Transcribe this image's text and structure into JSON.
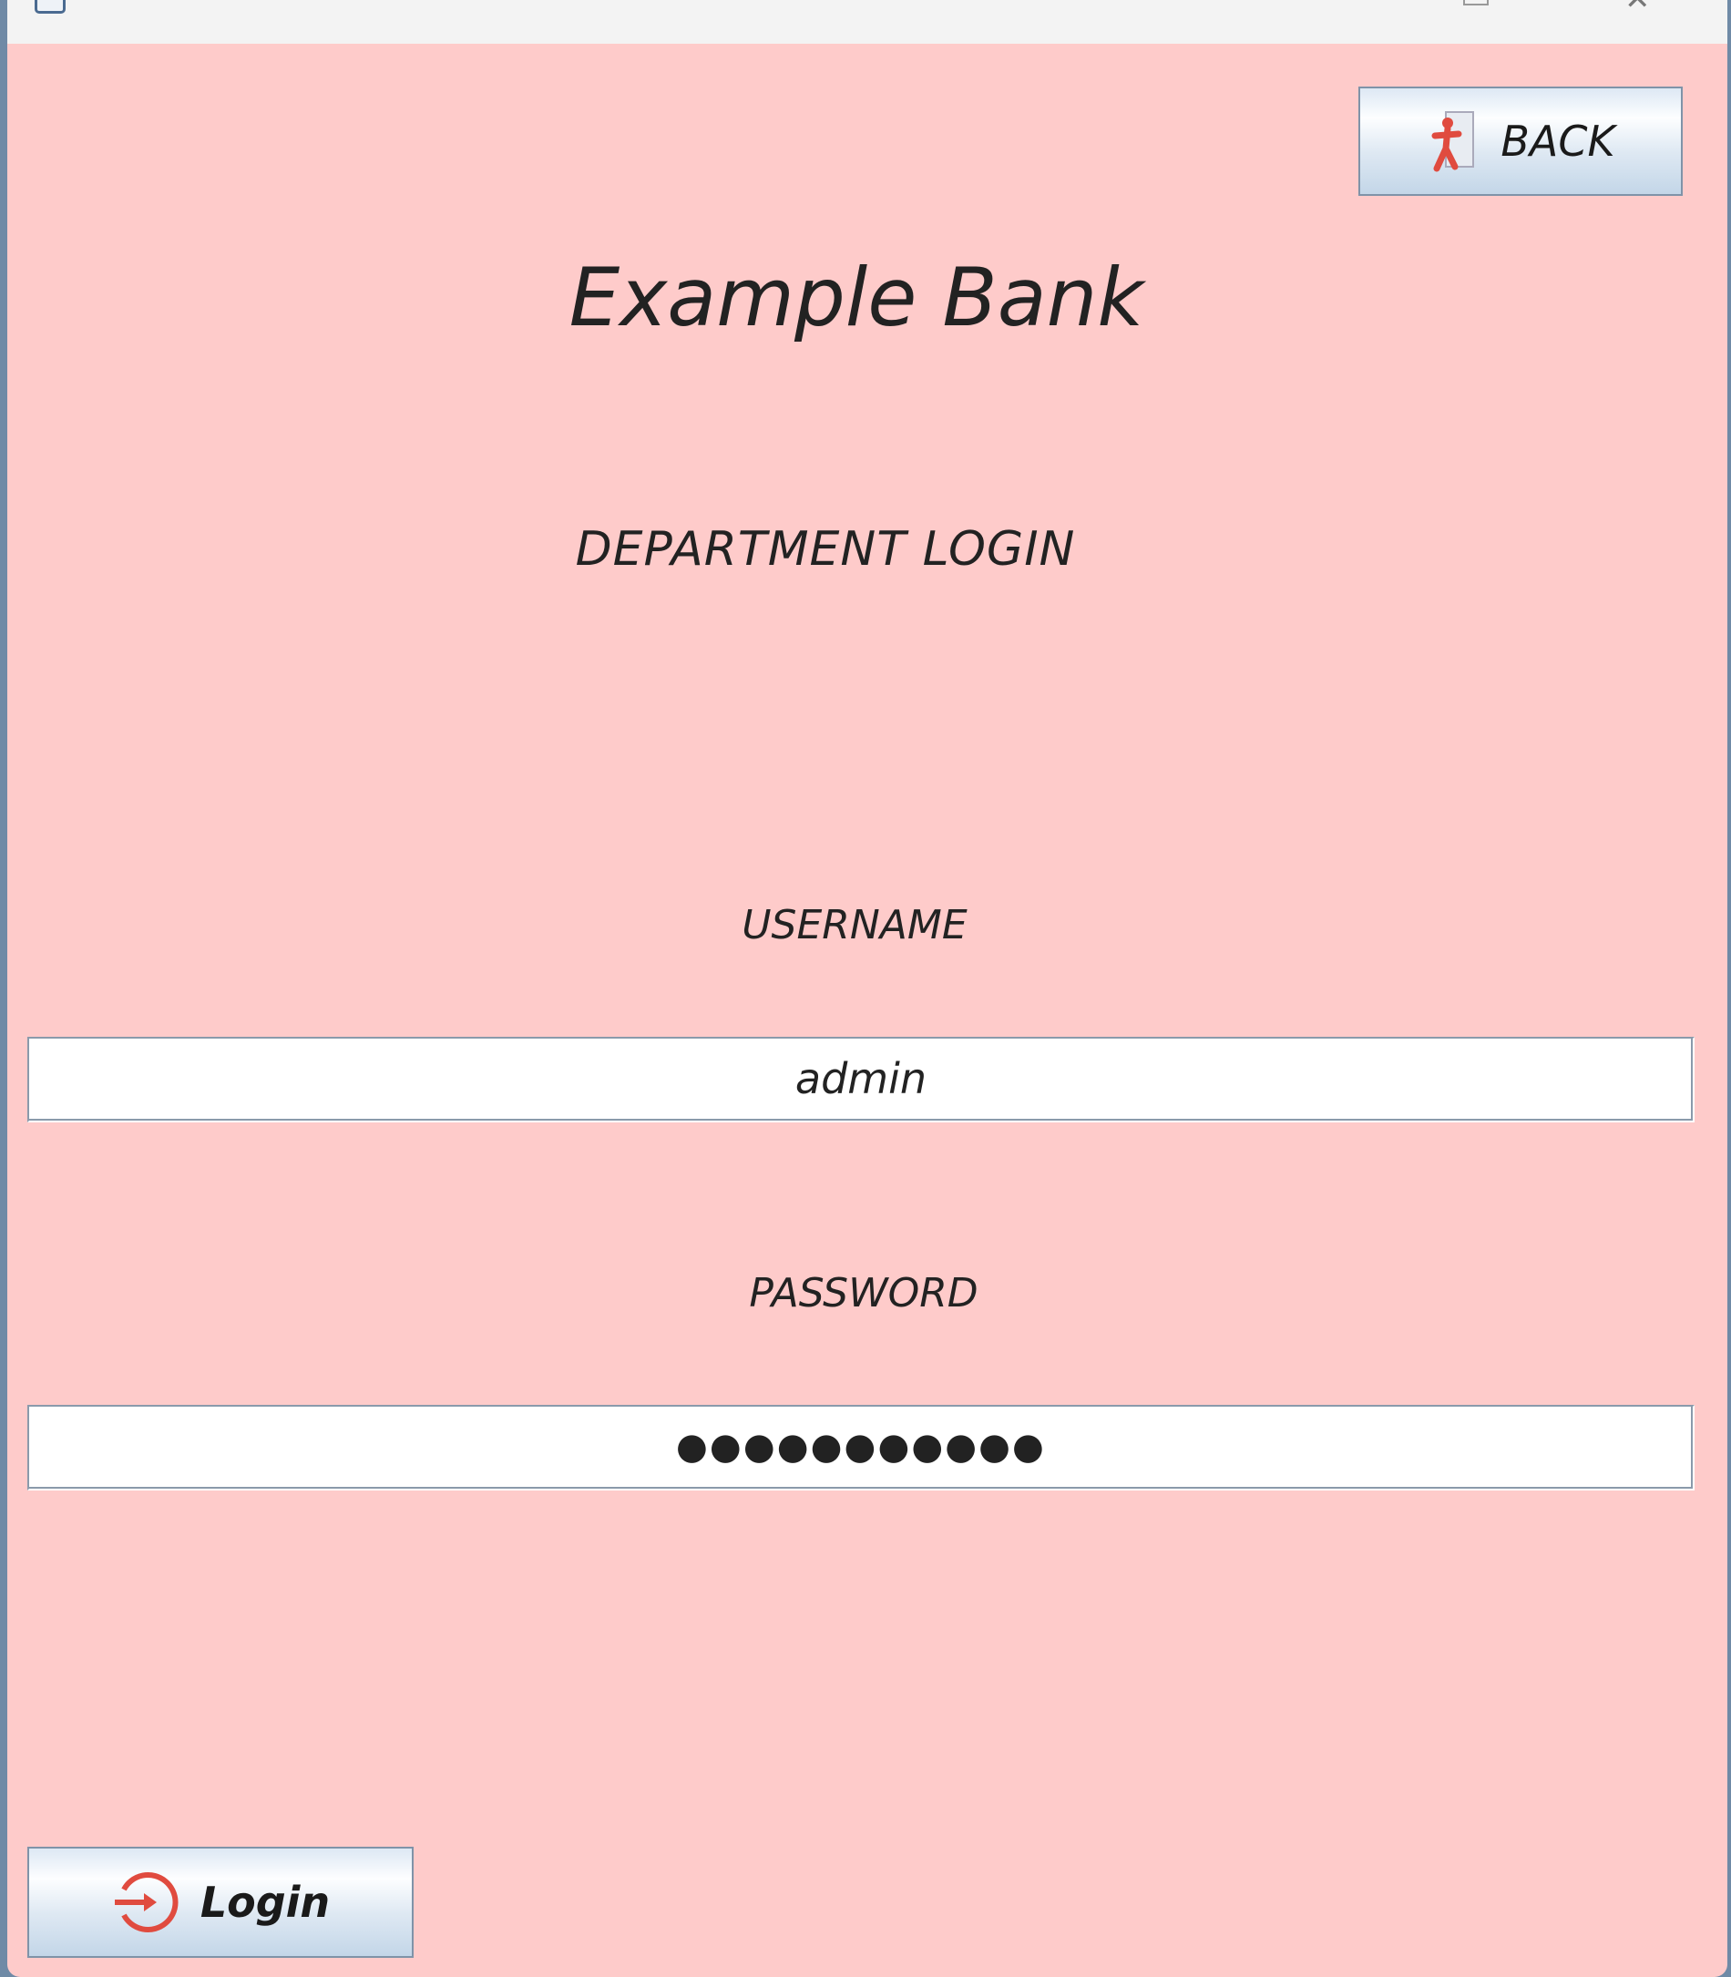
{
  "window": {
    "icons": [
      "app-icon",
      "maximize-icon",
      "close-icon"
    ]
  },
  "back_button": {
    "label": "BACK",
    "icon": "exit-door-icon"
  },
  "title": "Example Bank",
  "subtitle": "DEPARTMENT LOGIN",
  "username": {
    "label": "USERNAME",
    "value": "admin"
  },
  "password": {
    "label": "PASSWORD",
    "value": "●●●●●●●●●●●"
  },
  "login_button": {
    "label": "Login",
    "icon": "login-arrow-icon"
  },
  "colors": {
    "background": "#fecbca",
    "icon_red": "#e04b3f"
  }
}
